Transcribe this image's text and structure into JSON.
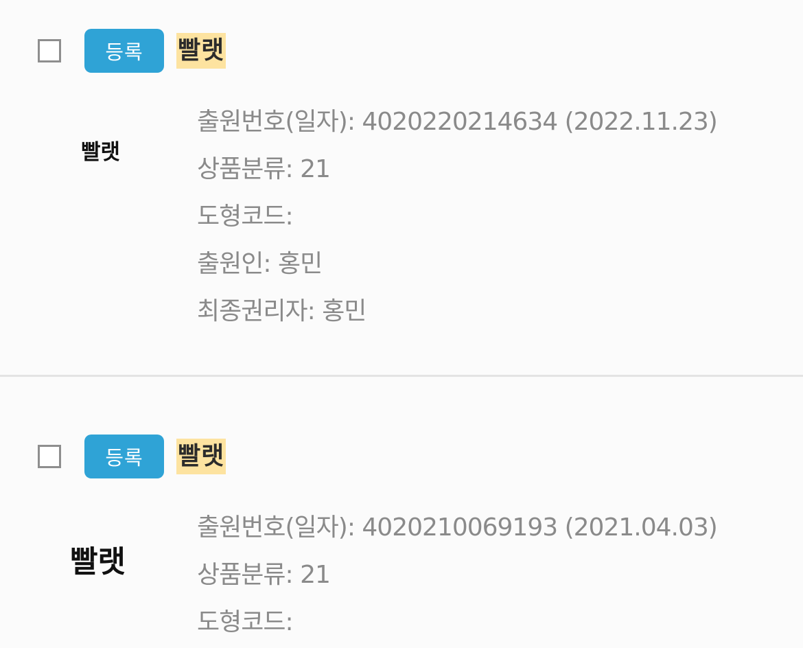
{
  "results": [
    {
      "status_badge": "등록",
      "title": "빨랫",
      "mark_text": "빨랫",
      "fields": [
        {
          "label": "출원번호(일자)",
          "value": "4020220214634 (2022.11.23)"
        },
        {
          "label": "상품분류",
          "value": "21"
        },
        {
          "label": "도형코드",
          "value": ""
        },
        {
          "label": "출원인",
          "value": "홍민"
        },
        {
          "label": "최종권리자",
          "value": "홍민"
        }
      ]
    },
    {
      "status_badge": "등록",
      "title": "빨랫",
      "mark_text": "빨랫",
      "fields": [
        {
          "label": "출원번호(일자)",
          "value": "4020210069193 (2021.04.03)"
        },
        {
          "label": "상품분류",
          "value": "21"
        },
        {
          "label": "도형코드",
          "value": ""
        }
      ]
    }
  ],
  "colors": {
    "badge": "#2fa3d6",
    "highlight": "#fde3a0",
    "field_text": "#8a8a8a",
    "separator": "#e3e3e3"
  }
}
